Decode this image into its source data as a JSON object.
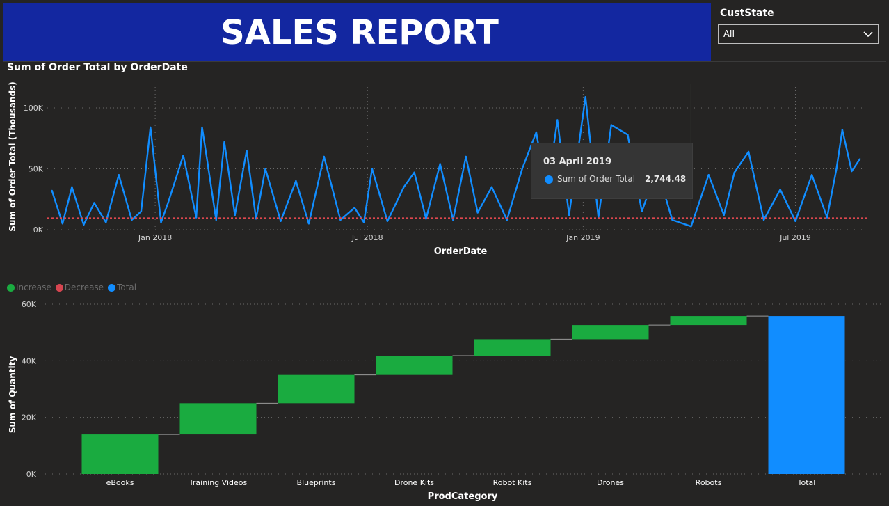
{
  "banner": {
    "title": "SALES REPORT"
  },
  "slicer": {
    "label": "CustState",
    "value": "All"
  },
  "colors": {
    "banner": "#1327a0",
    "line": "#118dff",
    "average": "#e0474f",
    "increase": "#1aab40",
    "decrease": "#d64550",
    "total": "#118dff",
    "background": "#252423"
  },
  "line_chart": {
    "title": "Sum of Order Total by OrderDate",
    "tooltip": {
      "date": "03 April 2019",
      "series": "Sum of Order Total",
      "value": "2,744.48"
    }
  },
  "waterfall_chart": {
    "legend": [
      {
        "label": "Increase",
        "color": "#1aab40"
      },
      {
        "label": "Decrease",
        "color": "#d64550"
      },
      {
        "label": "Total",
        "color": "#118dff"
      }
    ]
  },
  "chart_data": [
    {
      "type": "line",
      "title": "Sum of Order Total by OrderDate",
      "xlabel": "OrderDate",
      "ylabel": "Sum of Order Total (Thousands)",
      "x_range": [
        "2017-10-01",
        "2019-09-01"
      ],
      "x_ticks": [
        {
          "date": "2018-01-01",
          "label": "Jan 2018"
        },
        {
          "date": "2018-07-01",
          "label": "Jul 2018"
        },
        {
          "date": "2019-01-01",
          "label": "Jan 2019"
        },
        {
          "date": "2019-07-01",
          "label": "Jul 2019"
        }
      ],
      "ylim": [
        0,
        120000
      ],
      "y_ticks": [
        {
          "value": 0,
          "label": "0K"
        },
        {
          "value": 50000,
          "label": "50K"
        },
        {
          "value": 100000,
          "label": "100K"
        }
      ],
      "average_line": 9500,
      "grid": true,
      "series": [
        {
          "name": "Sum of Order Total",
          "points": [
            [
              "2017-10-05",
              32000
            ],
            [
              "2017-10-14",
              5000
            ],
            [
              "2017-10-22",
              35000
            ],
            [
              "2017-11-01",
              4000
            ],
            [
              "2017-11-10",
              22000
            ],
            [
              "2017-11-20",
              6000
            ],
            [
              "2017-12-01",
              45000
            ],
            [
              "2017-12-12",
              8000
            ],
            [
              "2017-12-20",
              15000
            ],
            [
              "2017-12-28",
              84000
            ],
            [
              "2018-01-06",
              6000
            ],
            [
              "2018-01-12",
              22000
            ],
            [
              "2018-01-25",
              61000
            ],
            [
              "2018-02-05",
              10000
            ],
            [
              "2018-02-10",
              84000
            ],
            [
              "2018-02-14",
              59000
            ],
            [
              "2018-02-22",
              8000
            ],
            [
              "2018-03-01",
              72000
            ],
            [
              "2018-03-10",
              12000
            ],
            [
              "2018-03-20",
              65000
            ],
            [
              "2018-03-28",
              9000
            ],
            [
              "2018-04-05",
              50000
            ],
            [
              "2018-04-18",
              7000
            ],
            [
              "2018-05-01",
              40000
            ],
            [
              "2018-05-12",
              5000
            ],
            [
              "2018-05-25",
              60000
            ],
            [
              "2018-06-08",
              8000
            ],
            [
              "2018-06-20",
              18000
            ],
            [
              "2018-06-28",
              6000
            ],
            [
              "2018-07-05",
              50000
            ],
            [
              "2018-07-18",
              7000
            ],
            [
              "2018-08-01",
              35000
            ],
            [
              "2018-08-10",
              47000
            ],
            [
              "2018-08-20",
              9000
            ],
            [
              "2018-09-01",
              54000
            ],
            [
              "2018-09-12",
              8000
            ],
            [
              "2018-09-23",
              60000
            ],
            [
              "2018-10-03",
              14000
            ],
            [
              "2018-10-15",
              35000
            ],
            [
              "2018-10-28",
              8000
            ],
            [
              "2018-11-10",
              50000
            ],
            [
              "2018-11-22",
              80000
            ],
            [
              "2018-12-01",
              30000
            ],
            [
              "2018-12-10",
              90000
            ],
            [
              "2018-12-20",
              12000
            ],
            [
              "2019-01-03",
              109000
            ],
            [
              "2019-01-14",
              10000
            ],
            [
              "2019-01-25",
              86000
            ],
            [
              "2019-02-08",
              78000
            ],
            [
              "2019-02-20",
              15000
            ],
            [
              "2019-03-05",
              50000
            ],
            [
              "2019-03-18",
              8000
            ],
            [
              "2019-04-03",
              2744.48
            ],
            [
              "2019-04-18",
              45000
            ],
            [
              "2019-05-01",
              12000
            ],
            [
              "2019-05-10",
              47000
            ],
            [
              "2019-05-22",
              64000
            ],
            [
              "2019-06-04",
              8000
            ],
            [
              "2019-06-18",
              33000
            ],
            [
              "2019-07-01",
              7000
            ],
            [
              "2019-07-15",
              45000
            ],
            [
              "2019-07-28",
              10000
            ],
            [
              "2019-08-05",
              50000
            ],
            [
              "2019-08-10",
              82000
            ],
            [
              "2019-08-18",
              48000
            ],
            [
              "2019-08-25",
              58000
            ]
          ]
        }
      ]
    },
    {
      "type": "waterfall",
      "xlabel": "ProdCategory",
      "ylabel": "Sum of Quantity",
      "ylim": [
        0,
        60000
      ],
      "y_ticks": [
        {
          "value": 0,
          "label": "0K"
        },
        {
          "value": 20000,
          "label": "20K"
        },
        {
          "value": 40000,
          "label": "40K"
        },
        {
          "value": 60000,
          "label": "60K"
        }
      ],
      "grid": true,
      "legend_position": "top-left",
      "categories": [
        "eBooks",
        "Training Videos",
        "Blueprints",
        "Drone Kits",
        "Robot Kits",
        "Drones",
        "Robots",
        "Total"
      ],
      "values": [
        14000,
        11000,
        10000,
        6800,
        5800,
        5000,
        3200,
        55800
      ],
      "kinds": [
        "increase",
        "increase",
        "increase",
        "increase",
        "increase",
        "increase",
        "increase",
        "total"
      ]
    }
  ]
}
